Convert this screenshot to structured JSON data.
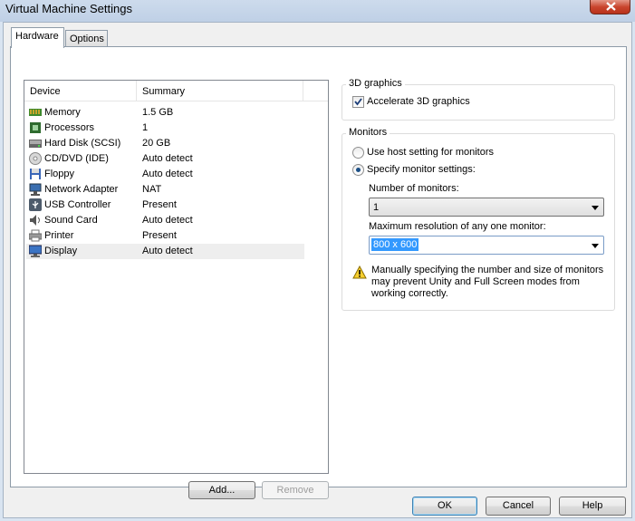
{
  "window": {
    "title": "Virtual Machine Settings"
  },
  "tabs": [
    {
      "label": "Hardware"
    },
    {
      "label": "Options"
    }
  ],
  "device_list": {
    "columns": {
      "device": "Device",
      "summary": "Summary"
    },
    "rows": [
      {
        "device": "Memory",
        "summary": "1.5 GB",
        "icon": "memory-icon"
      },
      {
        "device": "Processors",
        "summary": "1",
        "icon": "processor-icon"
      },
      {
        "device": "Hard Disk (SCSI)",
        "summary": "20 GB",
        "icon": "hard-disk-icon"
      },
      {
        "device": "CD/DVD (IDE)",
        "summary": "Auto detect",
        "icon": "cd-dvd-icon"
      },
      {
        "device": "Floppy",
        "summary": "Auto detect",
        "icon": "floppy-icon"
      },
      {
        "device": "Network Adapter",
        "summary": "NAT",
        "icon": "network-adapter-icon"
      },
      {
        "device": "USB Controller",
        "summary": "Present",
        "icon": "usb-icon"
      },
      {
        "device": "Sound Card",
        "summary": "Auto detect",
        "icon": "sound-card-icon"
      },
      {
        "device": "Printer",
        "summary": "Present",
        "icon": "printer-icon"
      },
      {
        "device": "Display",
        "summary": "Auto detect",
        "icon": "display-icon",
        "selected": true
      }
    ],
    "add_label": "Add...",
    "remove_label": "Remove"
  },
  "graphics_group": {
    "title": "3D graphics",
    "accelerate_label": "Accelerate 3D graphics",
    "accelerate_checked": true
  },
  "monitors_group": {
    "title": "Monitors",
    "use_host_label": "Use host setting for monitors",
    "specify_label": "Specify monitor settings:",
    "selected_option": "specify",
    "num_monitors_label": "Number of monitors:",
    "num_monitors_value": "1",
    "max_res_label": "Maximum resolution of any one monitor:",
    "max_res_value": "800 x 600",
    "warning_line1": "Manually specifying the number and size of monitors",
    "warning_line2": "may prevent Unity and Full Screen modes from",
    "warning_line3": "working correctly."
  },
  "footer": {
    "ok_label": "OK",
    "cancel_label": "Cancel",
    "help_label": "Help"
  }
}
